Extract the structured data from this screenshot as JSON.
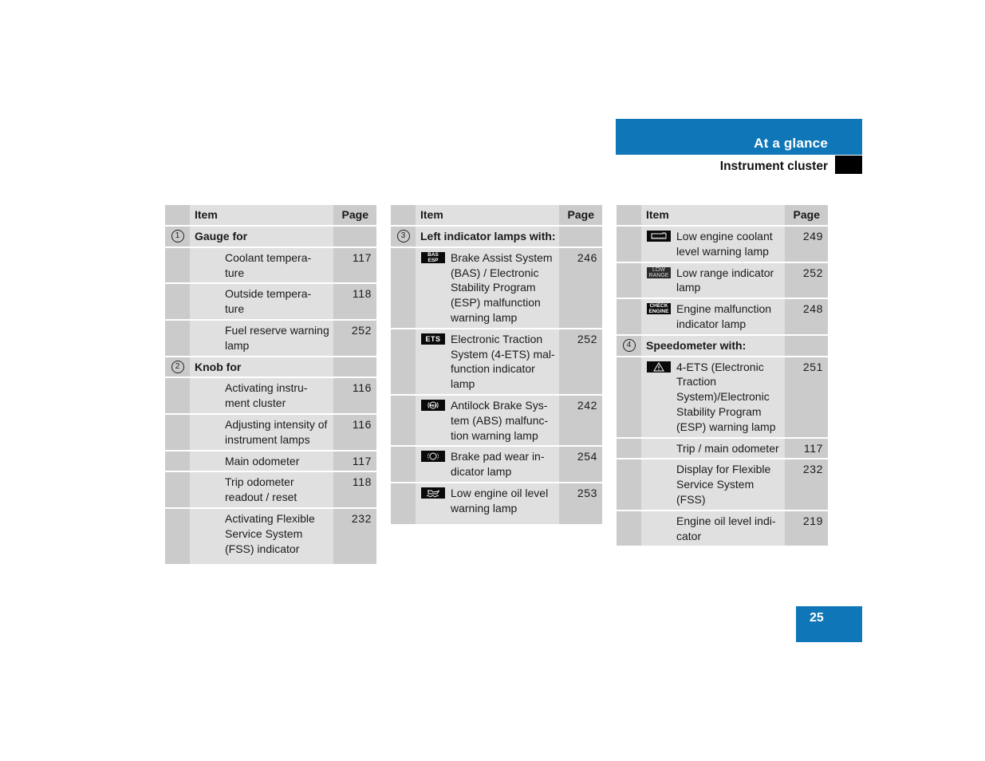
{
  "header": {
    "section_title": "At a glance",
    "subsection_title": "Instrument cluster"
  },
  "page_number": "25",
  "colors": {
    "brand_blue": "#0f77b8",
    "cell_light": "#e0e0e0",
    "cell_dark": "#cbcbcb"
  },
  "tables": [
    {
      "header": {
        "item": "Item",
        "page": "Page"
      },
      "rows": [
        {
          "type": "section",
          "number": "1",
          "label": "Gauge for",
          "page": ""
        },
        {
          "type": "entry",
          "icon": "",
          "label": "Coolant tempera-ture",
          "page": "117"
        },
        {
          "type": "entry",
          "icon": "",
          "label": "Outside tempera-ture",
          "page": "118"
        },
        {
          "type": "entry",
          "icon": "",
          "label": "Fuel reserve warning lamp",
          "page": "252"
        },
        {
          "type": "section",
          "number": "2",
          "label": "Knob for",
          "page": ""
        },
        {
          "type": "entry",
          "icon": "",
          "label": "Activating instru-ment cluster",
          "page": "116"
        },
        {
          "type": "entry",
          "icon": "",
          "label": "Adjusting intensity of instrument lamps",
          "page": "116"
        },
        {
          "type": "entry",
          "icon": "",
          "label": "Main odometer",
          "page": "117"
        },
        {
          "type": "entry",
          "icon": "",
          "label": "Trip odometer readout / reset",
          "page": "118"
        },
        {
          "type": "entry",
          "icon": "",
          "label": "Activating Flexible Service System (FSS) indicator",
          "page": "232"
        }
      ]
    },
    {
      "header": {
        "item": "Item",
        "page": "Page"
      },
      "rows": [
        {
          "type": "section",
          "number": "3",
          "label": "Left indicator lamps with:",
          "page": ""
        },
        {
          "type": "entry",
          "icon": "bas-esp-lamp-icon",
          "icon_text": [
            "BAS",
            "ESP"
          ],
          "label": "Brake Assist System (BAS) / Electronic Stability Program (ESP) malfunction warning lamp",
          "page": "246"
        },
        {
          "type": "entry",
          "icon": "ets-lamp-icon",
          "icon_text": [
            "ETS"
          ],
          "label": "Electronic Traction System (4-ETS) mal-function indicator lamp",
          "page": "252"
        },
        {
          "type": "entry",
          "icon": "abs-lamp-icon",
          "label": "Antilock Brake Sys-tem (ABS) malfunc-tion warning lamp",
          "page": "242"
        },
        {
          "type": "entry",
          "icon": "brake-pad-wear-lamp-icon",
          "label": "Brake pad wear in-dicator lamp",
          "page": "254"
        },
        {
          "type": "entry",
          "icon": "oil-level-lamp-icon",
          "label": "Low engine oil level warning lamp",
          "page": "253"
        }
      ]
    },
    {
      "header": {
        "item": "Item",
        "page": "Page"
      },
      "rows": [
        {
          "type": "entry",
          "icon": "coolant-level-lamp-icon",
          "label": "Low engine coolant level warning lamp",
          "page": "249"
        },
        {
          "type": "entry",
          "icon": "low-range-lamp-icon",
          "icon_text": [
            "LOW",
            "RANGE"
          ],
          "label": "Low range indicator lamp",
          "page": "252"
        },
        {
          "type": "entry",
          "icon": "check-engine-lamp-icon",
          "icon_text": [
            "CHECK",
            "ENGINE"
          ],
          "label": "Engine malfunction indicator lamp",
          "page": "248"
        },
        {
          "type": "section",
          "number": "4",
          "label": "Speedometer with:",
          "page": ""
        },
        {
          "type": "entry",
          "icon": "warning-triangle-lamp-icon",
          "label": "4-ETS (Electronic Traction System)/Electronic Stability Program (ESP) warning lamp",
          "page": "251"
        },
        {
          "type": "entry",
          "icon": "",
          "label": "Trip / main odometer",
          "page": "117"
        },
        {
          "type": "entry",
          "icon": "",
          "label": "Display for Flexible Service System (FSS)",
          "page": "232"
        },
        {
          "type": "entry",
          "icon": "",
          "label": "Engine oil level indi-cator",
          "page": "219"
        }
      ]
    }
  ]
}
